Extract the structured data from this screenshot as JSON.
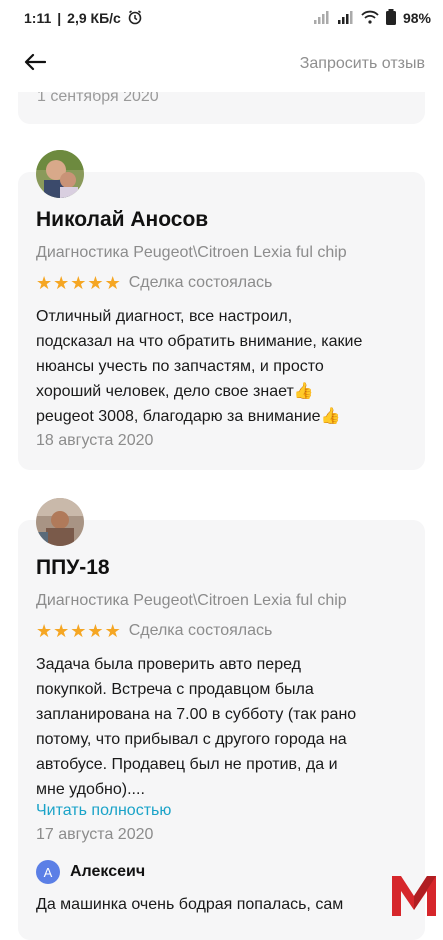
{
  "status_bar": {
    "time": "1:11",
    "speed": "2,9 КБ/с",
    "battery": "98"
  },
  "app_bar": {
    "back_icon": "arrow-left-icon",
    "request_review": "Запросить отзыв"
  },
  "reviews_above": {
    "date": "1 сентября 2020"
  },
  "reviews": [
    {
      "name": "Николай Аносов",
      "service": "Диагностика Peugeot\\Citroen Lexia ful chip",
      "stars": 5,
      "deal_status": "Сделка состоялась",
      "text_lines": [
        "Отличный диагност, все настроил,",
        "подсказал на что обратить внимание, какие",
        "нюансы учесть по запчастям, и просто",
        "хороший человек, дело свое знает👍",
        "peugeot 3008, благодарю за внимание👍"
      ],
      "date": "18 августа 2020"
    },
    {
      "name": "ППУ-18",
      "service": "Диагностика Peugeot\\Citroen Lexia ful chip",
      "stars": 5,
      "deal_status": "Сделка состоялась",
      "text_lines": [
        "Задача была проверить авто перед",
        "покупкой. Встреча с продавцом была",
        "запланирована  на 7.00 в субботу (так рано",
        "потому, что прибывал с другого города на",
        "автобусе. Продавец был не против, да и",
        "мне удобно)...."
      ],
      "read_more": "Читать полностью",
      "date": "17 августа 2020",
      "reply": {
        "initial": "А",
        "name": "Алексеич",
        "text": "Да машинка очень бодрая попалась, сам"
      }
    }
  ],
  "colors": {
    "accent_link": "#1aa3c8",
    "star": "#f5a623",
    "card_bg": "#f6f6f7",
    "watermark_red": "#d6262b"
  }
}
